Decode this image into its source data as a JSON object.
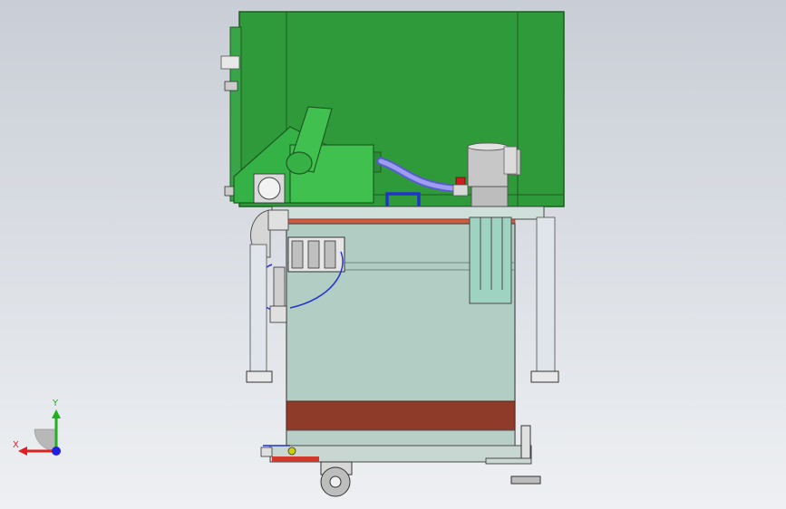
{
  "viewport": {
    "background_top": "#c9ced6",
    "background_bottom": "#eef0f3"
  },
  "model": {
    "hood_color": "#2e9a3a",
    "tank_fluid_color": "#a9c9bd",
    "sludge_color": "#8e3b2a",
    "hose_color": "#7f7fe0"
  },
  "triad": {
    "x_label": "X",
    "y_label": "Y",
    "x_color": "#e02020",
    "y_color": "#20b020",
    "z_color": "#2020e0"
  }
}
